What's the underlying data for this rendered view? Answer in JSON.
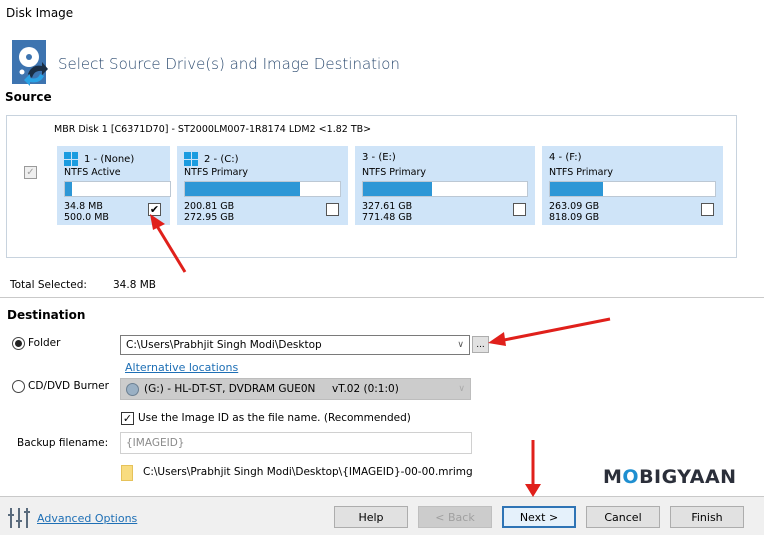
{
  "window": {
    "title": "Disk Image"
  },
  "header": {
    "title": "Select Source Drive(s) and Image Destination",
    "icon": "disk-image-icon"
  },
  "source": {
    "label": "Source",
    "disk": {
      "label": "MBR Disk 1 [C6371D70] - ST2000LM007-1R8174 LDM2  <1.82 TB>",
      "checked": true,
      "partitions": [
        {
          "title": "1 - (None)",
          "type": "NTFS Active",
          "used": "34.8 MB",
          "total": "500.0 MB",
          "usage_fraction": 0.07,
          "checked": true,
          "windows_icon": true
        },
        {
          "title": "2 - (C:)",
          "type": "NTFS Primary",
          "used": "200.81 GB",
          "total": "272.95 GB",
          "usage_fraction": 0.74,
          "checked": false,
          "windows_icon": true
        },
        {
          "title": "3 - (E:)",
          "type": "NTFS Primary",
          "used": "327.61 GB",
          "total": "771.48 GB",
          "usage_fraction": 0.42,
          "checked": false,
          "windows_icon": false
        },
        {
          "title": "4 - (F:)",
          "type": "NTFS Primary",
          "used": "263.09 GB",
          "total": "818.09 GB",
          "usage_fraction": 0.32,
          "checked": false,
          "windows_icon": false
        }
      ]
    },
    "total_selected_label": "Total Selected:",
    "total_selected_value": "34.8 MB"
  },
  "destination": {
    "label": "Destination",
    "folder_option": {
      "label": "Folder",
      "selected": true,
      "value": "C:\\Users\\Prabhjit Singh Modi\\Desktop",
      "browse_label": "..."
    },
    "alt_locations_link": "Alternative locations",
    "burner_option": {
      "label": "CD/DVD Burner",
      "selected": false,
      "value": "(G:) - HL-DT-ST, DVDRAM GUE0N     vT.02 (0:1:0)"
    },
    "use_image_id": {
      "label": "Use the Image ID as the file name.  (Recommended)",
      "checked": true
    },
    "backup_filename_label": "Backup filename:",
    "backup_filename_value": "{IMAGEID}",
    "path_preview": "C:\\Users\\Prabhjit Singh Modi\\Desktop\\{IMAGEID}-00-00.mrimg"
  },
  "footer": {
    "advanced_options": "Advanced Options",
    "buttons": {
      "help": "Help",
      "back": "< Back",
      "next": "Next >",
      "cancel": "Cancel",
      "finish": "Finish"
    }
  },
  "watermark": {
    "pre": "M",
    "o": "O",
    "post": "BIGYAAN"
  },
  "colors": {
    "accent": "#2d97d6",
    "partition_bg": "#cfe4f8",
    "link": "#1e6fb5",
    "arrow": "#e0201b"
  }
}
